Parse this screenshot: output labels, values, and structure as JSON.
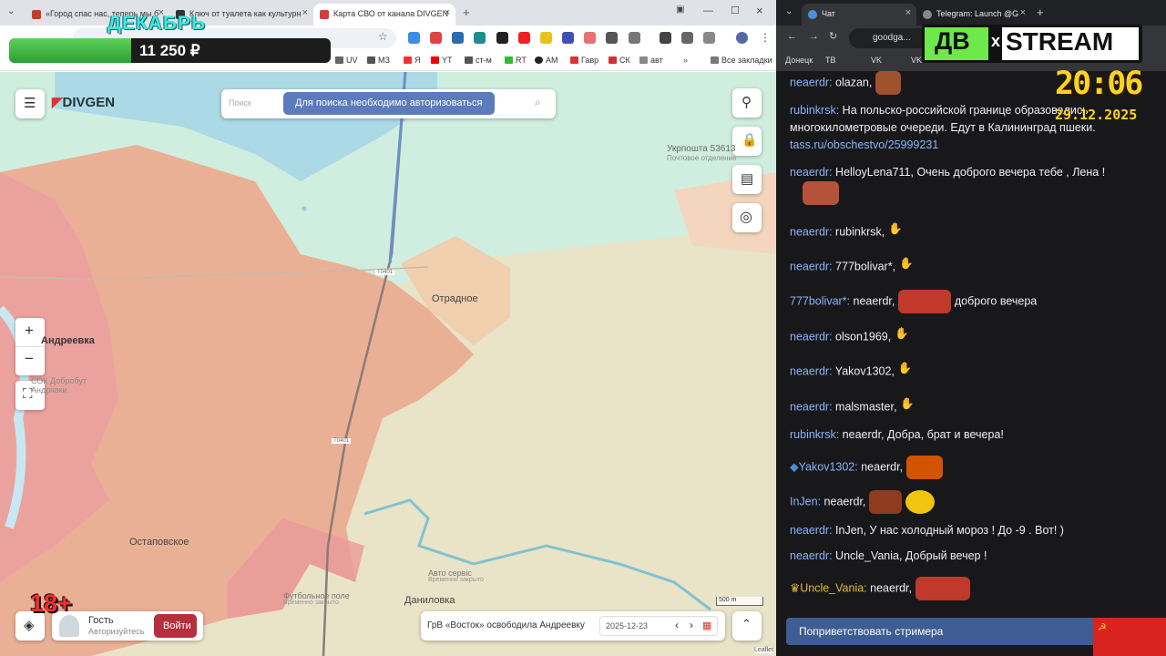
{
  "left_browser": {
    "tabs": [
      {
        "title": "«Город спас нас, теперь мы б",
        "favicon_color": "#c83a2e"
      },
      {
        "title": "Ключ от туалета как культурн",
        "favicon_color": "#333333"
      },
      {
        "title": "Карта СВО от канала DIVGEN",
        "favicon_color": "#d73b3b"
      }
    ],
    "new_tab": "+",
    "bookmarks": [
      "UV",
      "МЗ",
      "Я",
      "YT",
      "ст-м",
      "RT",
      "АМ",
      "Гавр",
      "СК",
      "авт",
      "Все закладки"
    ]
  },
  "overlay": {
    "month": "ДЕКАБРЬ",
    "donation_amount": "11 250 ₽",
    "donation_progress_percent": 38,
    "age_rating": "18+"
  },
  "map": {
    "brand": "DIVGEN",
    "search_placeholder": "Поиск",
    "search_auth_notice": "Для поиска необходимо авторизоваться",
    "zoom_in": "+",
    "zoom_out": "−",
    "places": [
      {
        "name": "Отрадное"
      },
      {
        "name": "Андреевка"
      },
      {
        "name": "СОК Добробут Андріївки"
      },
      {
        "name": "Остаповское"
      },
      {
        "name": "Даниловка"
      },
      {
        "name": "Укрпошта 53613"
      },
      {
        "name": "Почтовое отделение"
      },
      {
        "name": "Авто сервіс"
      },
      {
        "name": "Временно закрыто"
      },
      {
        "name": "Футбольное поле"
      },
      {
        "name": "Временно закрыто"
      }
    ],
    "road_labels": [
      "T0401",
      "T0401"
    ],
    "scale": "500 m",
    "user": {
      "name": "Гость",
      "subtitle": "Авторизуйтесь",
      "login_button": "Войти"
    },
    "news_headline": "ГрВ «Восток» освободила Андреевку",
    "date": "2025-12-23",
    "attribution": "Leaflet"
  },
  "right_browser": {
    "tabs": [
      {
        "title": "Чат"
      },
      {
        "title": "Telegram: Launch @G"
      }
    ],
    "address": "goodga...",
    "bookmarks": [
      "Донецк",
      "ТВ",
      "VK",
      "VK"
    ]
  },
  "stream_logo": {
    "left": "ДВ",
    "cross": "x",
    "right": "STREAM"
  },
  "clock": {
    "time": "20:06",
    "date": "29.12.2025"
  },
  "chat": {
    "messages": [
      {
        "user": "neaerdr:",
        "text": " olazan,"
      },
      {
        "user": "rubinkrsk:",
        "text": " На польско-российской границе образовались многокилометровые очереди. Едут в Калининград пшеки.",
        "link": "tass.ru/obschestvo/25999231"
      },
      {
        "user": "neaerdr:",
        "text": " HelloyLena711, Очень доброго вечера тебе , Лена !"
      },
      {
        "user": "neaerdr:",
        "text": " rubinkrsk,"
      },
      {
        "user": "neaerdr:",
        "text": " 777bolivar*,"
      },
      {
        "user": "777bolivar*:",
        "text": " neaerdr,",
        "after": " доброго вечера"
      },
      {
        "user": "neaerdr:",
        "text": " olson1969,"
      },
      {
        "user": "neaerdr:",
        "text": " Yakov1302,"
      },
      {
        "user": "neaerdr:",
        "text": " malsmaster,"
      },
      {
        "user": "rubinkrsk:",
        "text": " neaerdr, Добра, брат и вечера!"
      },
      {
        "user": "Yakov1302:",
        "text": " neaerdr,"
      },
      {
        "user": "InJen:",
        "text": " neaerdr,"
      },
      {
        "user": "neaerdr:",
        "text": " InJen, У нас холодный мороз ! До -9 . Вот! )"
      },
      {
        "user": "neaerdr:",
        "text": " Uncle_Vania, Добрый вечер !"
      },
      {
        "user": "Uncle_Vania:",
        "text": " neaerdr,"
      }
    ],
    "greet_button": "Поприветствовать стримера"
  }
}
